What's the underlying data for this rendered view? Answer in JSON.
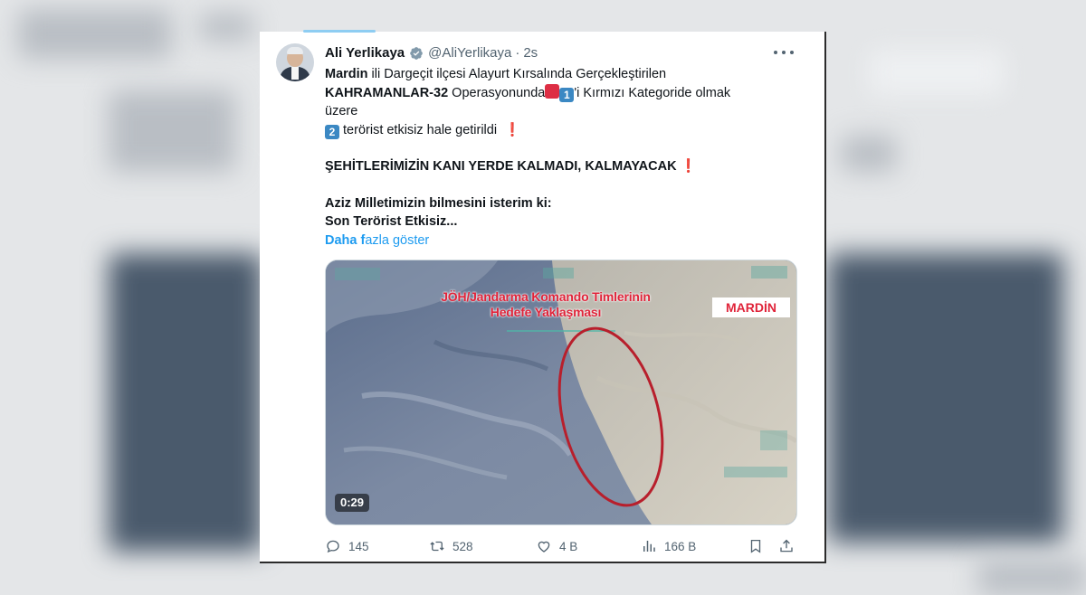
{
  "tweet": {
    "author_name": "Ali Yerlikaya",
    "handle": "@AliYerlikaya",
    "separator": "·",
    "time": "2s",
    "line1_bold": "Mardin",
    "line1_rest": " ili Dargeçit ilçesi Alayurt Kırsalında Gerçekleştirilen",
    "line2_bold": "KAHRAMANLAR-32",
    "line2_rest": " Operasyonunda",
    "line2_box": "1",
    "line2_tail": "'i Kırmızı Kategoride olmak",
    "line3": "üzere",
    "line4_box": "2",
    "line4_rest": " terörist etkisiz hale getirildi",
    "excl": "❗",
    "line5": "ŞEHİTLERİMİZİN KANI YERDE KALMADI, KALMAYACAK",
    "line6": "Aziz Milletimizin bilmesini isterim ki:",
    "line7": "Son Terörist Etkisiz...",
    "show_more_bold": "Daha f",
    "show_more_rest": "azla göster"
  },
  "media": {
    "overlay_line1": "JÖH/Jandarma Komando Timlerinin",
    "overlay_line2": "Hedefe Yaklaşması",
    "location_badge": "MARDİN",
    "duration": "0:29"
  },
  "actions": {
    "replies": "145",
    "reposts": "528",
    "likes": "4 B",
    "views": "166 B"
  },
  "colors": {
    "accent": "#1d9bf0",
    "text": "#0f1419",
    "muted": "#536471",
    "red": "#dd2e44",
    "emoji_blue": "#3b88c3"
  },
  "icons": {
    "verified": "verified-badge-icon",
    "more": "more-dots-icon",
    "reply": "reply-icon",
    "repost": "repost-icon",
    "like": "heart-icon",
    "views": "views-icon",
    "bookmark": "bookmark-icon",
    "share": "share-icon"
  }
}
